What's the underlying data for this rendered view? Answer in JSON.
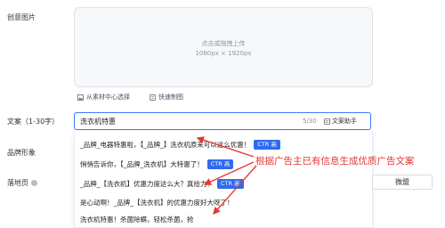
{
  "fields": {
    "creative_image_label": "创意图片",
    "text_label": "文案（1-30字）",
    "brand_image_label": "品牌形象",
    "landing_page_label": "落地页"
  },
  "upload": {
    "prompt": "点击或拖拽上传",
    "size_hint": "1080px × 1920px",
    "from_material": "从素材中心选择",
    "quick_create": "快速制图"
  },
  "text_input": {
    "value": "洗衣机特惠",
    "char_count": "5/30",
    "assistant_label": "文案助手"
  },
  "suggestions": [
    {
      "text": "_品牌_电器特惠啦，【_品牌_】洗衣机原来可以这么优惠！",
      "badge": "CTR 高"
    },
    {
      "text": "悄悄告诉你，【_品牌_洗衣机】大特惠了！",
      "badge": "CTR 高"
    },
    {
      "text": "_品牌_【洗衣机】优惠力度这么大？真给力！",
      "badge": "CTR 高"
    },
    {
      "text": "是心动啊！_品牌_【洗衣机】的优惠力度好大呀了！",
      "badge": ""
    },
    {
      "text": "洗衣机特惠！杀菌除螨，轻松杀菌，抢",
      "badge": ""
    }
  ],
  "wd_button_label": "微盟",
  "annotation": "根据广告主已有信息生成优质广告文案",
  "colors": {
    "accent": "#2f6bf0",
    "annotation": "#e53935"
  }
}
